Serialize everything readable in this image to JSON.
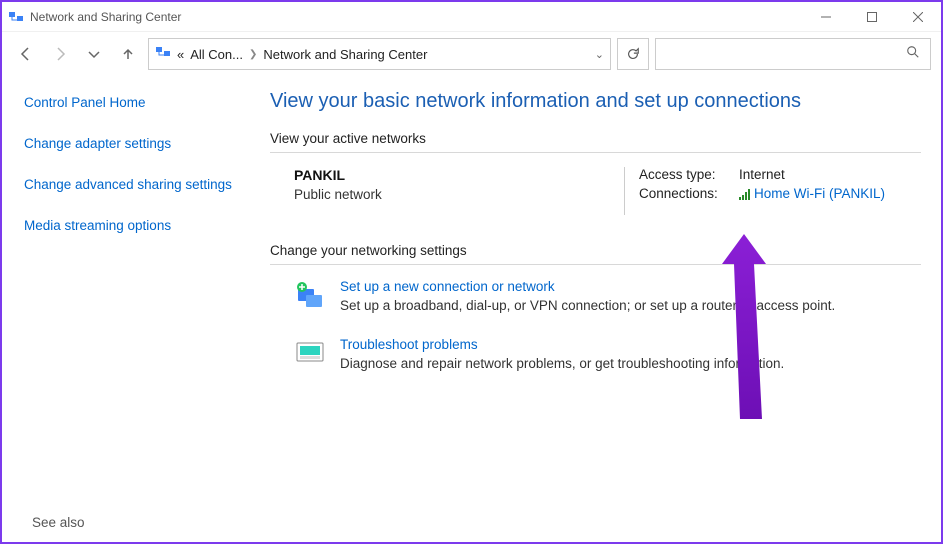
{
  "window": {
    "title": "Network and Sharing Center"
  },
  "breadcrumb": {
    "root_prefix": "«",
    "root": "All Con...",
    "current": "Network and Sharing Center"
  },
  "sidebar": {
    "home": "Control Panel Home",
    "adapter": "Change adapter settings",
    "advanced": "Change advanced sharing settings",
    "media": "Media streaming options",
    "seealso": "See also"
  },
  "main": {
    "heading": "View your basic network information and set up connections",
    "active_label": "View your active networks",
    "network": {
      "name": "PANKIL",
      "type": "Public network",
      "access_label": "Access type:",
      "access_value": "Internet",
      "conn_label": "Connections:",
      "conn_value": "Home Wi-Fi (PANKIL)"
    },
    "change_label": "Change your networking settings",
    "setup": {
      "title": "Set up a new connection or network",
      "desc": "Set up a broadband, dial-up, or VPN connection; or set up a router or access point."
    },
    "troubleshoot": {
      "title": "Troubleshoot problems",
      "desc": "Diagnose and repair network problems, or get troubleshooting information."
    }
  }
}
